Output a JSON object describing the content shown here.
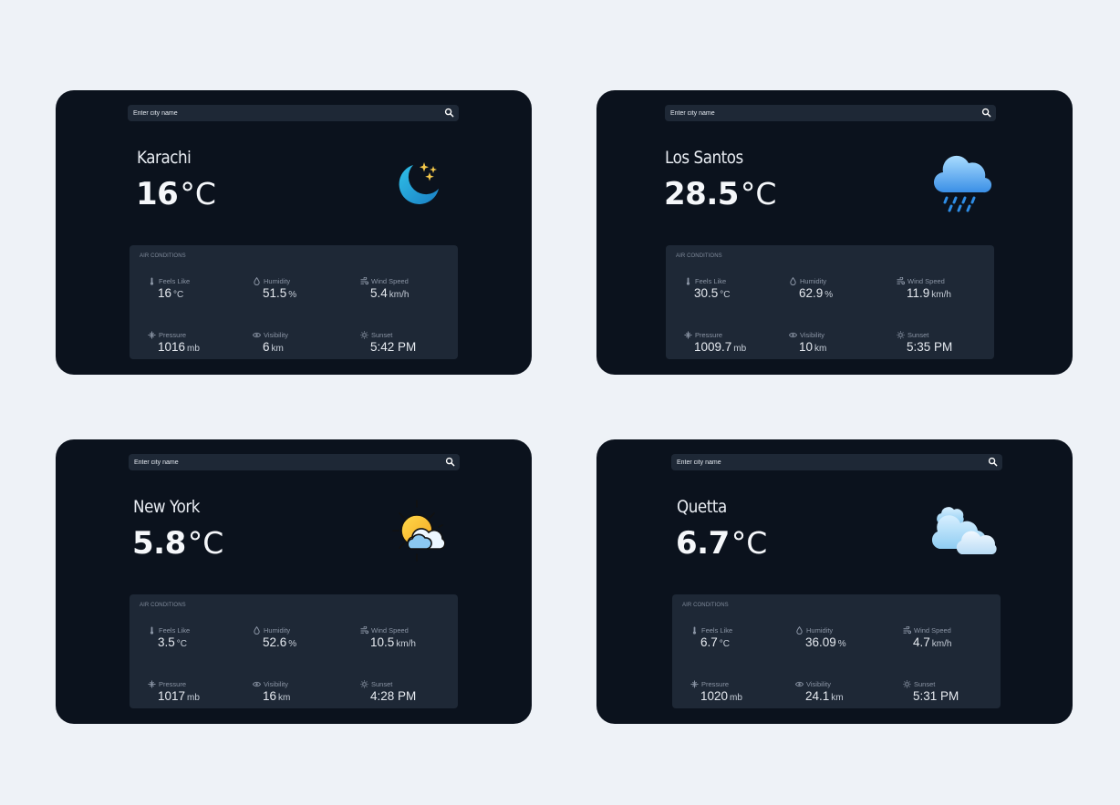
{
  "search": {
    "placeholder": "Enter city name"
  },
  "air_conditions_label": "AIR CONDITIONS",
  "metric_labels": {
    "feels_like": "Feels Like",
    "humidity": "Humidity",
    "wind_speed": "Wind Speed",
    "pressure": "Pressure",
    "visibility": "Visibility",
    "sunset": "Sunset"
  },
  "colors": {
    "page_bg": "#eef2f7",
    "card_bg": "#0b121d",
    "panel_bg": "#1e2836"
  },
  "cards": [
    {
      "city": "Karachi",
      "temp": "16",
      "temp_unit": "°C",
      "icon": "crescent-moon-stars-icon",
      "feels_like": "16",
      "feels_like_unit": "°C",
      "humidity": "51.5",
      "humidity_unit": "%",
      "wind_speed": "5.4",
      "wind_speed_unit": "km/h",
      "pressure": "1016",
      "pressure_unit": "mb",
      "visibility": "6",
      "visibility_unit": "km",
      "sunset": "5:42 PM"
    },
    {
      "city": "Los Santos",
      "temp": "28.5",
      "temp_unit": "°C",
      "icon": "rain-cloud-icon",
      "feels_like": "30.5",
      "feels_like_unit": "°C",
      "humidity": "62.9",
      "humidity_unit": "%",
      "wind_speed": "11.9",
      "wind_speed_unit": "km/h",
      "pressure": "1009.7",
      "pressure_unit": "mb",
      "visibility": "10",
      "visibility_unit": "km",
      "sunset": "5:35 PM"
    },
    {
      "city": "New York",
      "temp": "5.8",
      "temp_unit": "°C",
      "icon": "partly-cloudy-sun-icon",
      "feels_like": "3.5",
      "feels_like_unit": "°C",
      "humidity": "52.6",
      "humidity_unit": "%",
      "wind_speed": "10.5",
      "wind_speed_unit": "km/h",
      "pressure": "1017",
      "pressure_unit": "mb",
      "visibility": "16",
      "visibility_unit": "km",
      "sunset": "4:28 PM"
    },
    {
      "city": "Quetta",
      "temp": "6.7",
      "temp_unit": "°C",
      "icon": "clouds-icon",
      "feels_like": "6.7",
      "feels_like_unit": "°C",
      "humidity": "36.09",
      "humidity_unit": "%",
      "wind_speed": "4.7",
      "wind_speed_unit": "km/h",
      "pressure": "1020",
      "pressure_unit": "mb",
      "visibility": "24.1",
      "visibility_unit": "km",
      "sunset": "5:31 PM"
    }
  ]
}
